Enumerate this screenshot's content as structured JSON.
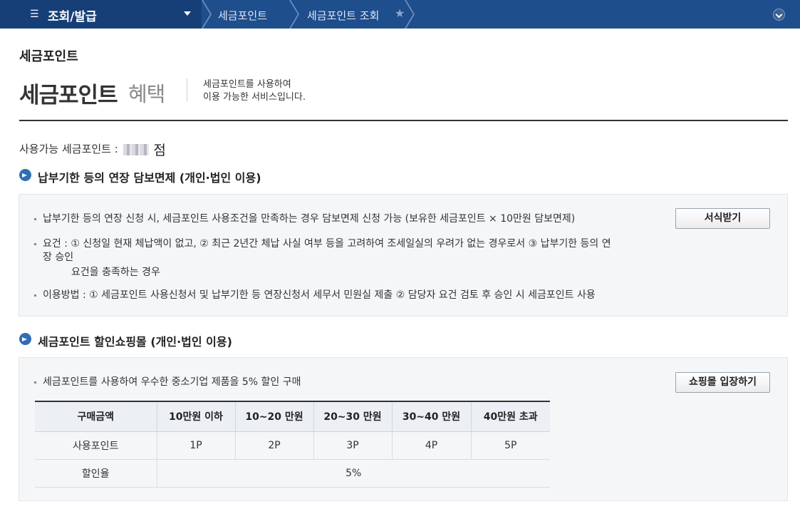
{
  "nav": {
    "menu_label": "조회/발급",
    "crumb1": "세금포인트",
    "crumb2": "세금포인트 조회"
  },
  "page": {
    "title": "세금포인트",
    "benefit_main": "세금포인트",
    "benefit_sub": "혜택",
    "intro_line1": "세금포인트를 사용하여",
    "intro_line2": "이용 가능한 서비스입니다.",
    "available_label": "사용가능 세금포인트 :",
    "available_unit": "점"
  },
  "section1": {
    "title": "납부기한 등의 연장 담보면제 (개인·법인 이용)",
    "bullet1": "납부기한 등의 연장 신청 시, 세금포인트 사용조건을 만족하는 경우 담보면제 신청 가능 (보유한 세금포인트 × 10만원 담보면제)",
    "bullet2_line1": "요건 : ① 신청일 현재 체납액이 없고, ② 최근 2년간 체납 사실 여부 등을 고려하여 조세일실의 우려가 없는 경우로서 ③ 납부기한 등의 연",
    "bullet2_line2": "장 승인",
    "bullet2_line3": "요건을 충족하는 경우",
    "bullet3": "이용방법 : ① 세금포인트 사용신청서 및 납부기한 등 연장신청서 세무서 민원실 제출 ② 담당자 요건 검토 후 승인 시 세금포인트 사용",
    "button": "서식받기"
  },
  "section2": {
    "title": "세금포인트 할인쇼핑몰 (개인·법인 이용)",
    "bullet1": "세금포인트를 사용하여 우수한 중소기업 제품을 5% 할인 구매",
    "button": "쇼핑몰 입장하기",
    "table": {
      "headers": [
        "구매금액",
        "10만원 이하",
        "10~20 만원",
        "20~30 만원",
        "30~40 만원",
        "40만원 초과"
      ],
      "row1": [
        "사용포인트",
        "1P",
        "2P",
        "3P",
        "4P",
        "5P"
      ],
      "row2_label": "할인율",
      "row2_value": "5%"
    }
  },
  "colors": {
    "nav_bg": "#1f4e8c",
    "nav_menu_bg": "#173f77",
    "section_icon": "#2f6eb5",
    "box_bg": "#f4f6f8"
  }
}
